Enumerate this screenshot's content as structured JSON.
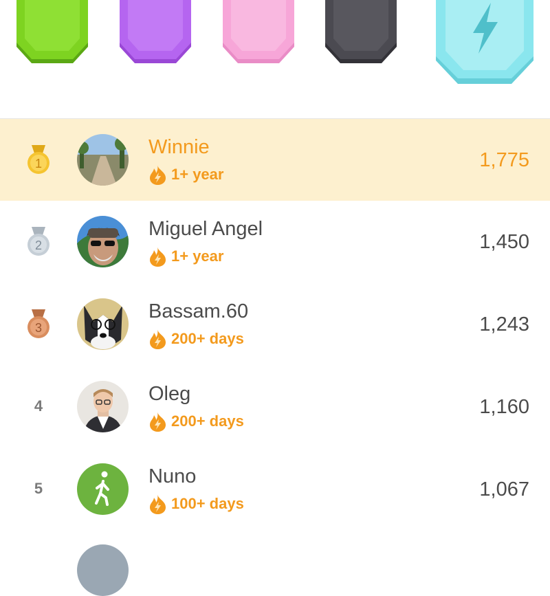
{
  "leagues": [
    {
      "name": "green-league",
      "color": "#7ed321"
    },
    {
      "name": "purple-league",
      "color": "#b565f0"
    },
    {
      "name": "pink-league",
      "color": "#f7a6d8"
    },
    {
      "name": "obsidian-league",
      "color": "#4b4a51"
    },
    {
      "name": "diamond-league",
      "color": "#8ae6ee",
      "icon": "lightning-bolt-icon"
    }
  ],
  "leaderboard": {
    "entries": [
      {
        "rank": "1",
        "name": "Winnie",
        "streak": "1+ year",
        "xp": "1,775",
        "highlight": true,
        "medal": "gold"
      },
      {
        "rank": "2",
        "name": "Miguel Angel",
        "streak": "1+ year",
        "xp": "1,450",
        "medal": "silver"
      },
      {
        "rank": "3",
        "name": "Bassam.60",
        "streak": "200+ days",
        "xp": "1,243",
        "medal": "bronze"
      },
      {
        "rank": "4",
        "name": "Oleg",
        "streak": "200+ days",
        "xp": "1,160"
      },
      {
        "rank": "5",
        "name": "Nuno",
        "streak": "100+ days",
        "xp": "1,067"
      }
    ]
  },
  "colors": {
    "highlight_bg": "#fdf0cf",
    "accent": "#f39a1d",
    "text": "#4b4b4b",
    "gold": "#f5c430",
    "silver": "#c5ced6",
    "bronze": "#d98d5e"
  }
}
